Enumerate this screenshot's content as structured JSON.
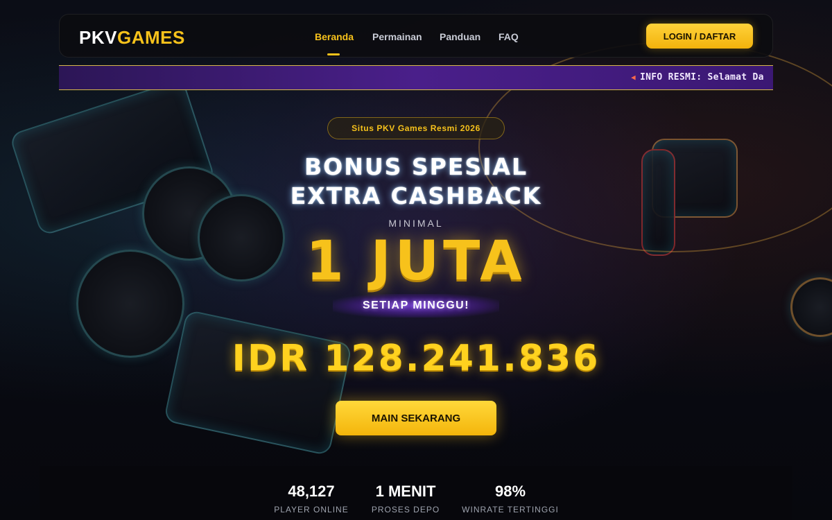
{
  "header": {
    "logo_main": "PKV",
    "logo_accent": "GAMES",
    "nav": [
      {
        "label": "Beranda",
        "active": true
      },
      {
        "label": "Permainan",
        "active": false
      },
      {
        "label": "Panduan",
        "active": false
      },
      {
        "label": "FAQ",
        "active": false
      }
    ],
    "login_label": "LOGIN / DAFTAR"
  },
  "ticker": {
    "icon": "megaphone-icon",
    "text": "INFO RESMI: Selamat Da"
  },
  "hero": {
    "badge": "Situs PKV Games Resmi 2026",
    "title_line1": "BONUS SPESIAL",
    "title_line2": "EXTRA CASHBACK",
    "minimal_label": "MINIMAL",
    "amount": "1 JUTA",
    "frequency": "SETIAP MINGGU!",
    "jackpot": "IDR 128.241.836",
    "cta_label": "MAIN SEKARANG"
  },
  "stats": [
    {
      "value": "48,127",
      "label": "PLAYER ONLINE"
    },
    {
      "value": "1 MENIT",
      "label": "PROSES DEPO"
    },
    {
      "value": "98%",
      "label": "WINRATE TERTINGGI"
    }
  ],
  "colors": {
    "accent": "#f7c21b",
    "ticker_bg": "#4a1f8a",
    "background": "#07080d"
  }
}
